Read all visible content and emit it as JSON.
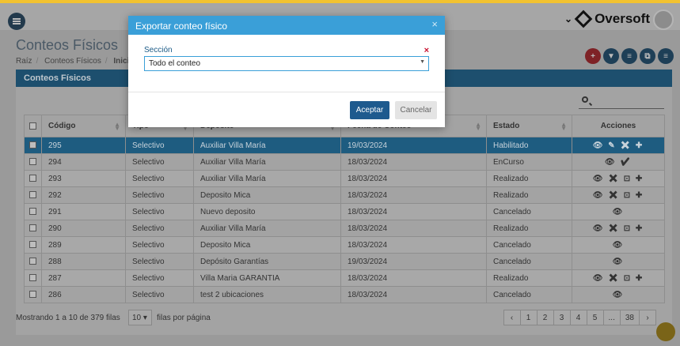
{
  "header": {
    "brand": "Oversoft"
  },
  "page": {
    "title": "Conteos Físicos",
    "breadcrumb": [
      "Raíz",
      "Conteos Físicos",
      "Inicio"
    ],
    "action_circles": [
      "+",
      "▼",
      "≡",
      "⧉",
      "≡"
    ]
  },
  "panel": {
    "title": "Conteos Físicos"
  },
  "table": {
    "columns": [
      "Código",
      "Tipo",
      "Depósito",
      "Fecha de Conteo",
      "Estado",
      "Acciones"
    ],
    "rows": [
      {
        "codigo": "295",
        "tipo": "Selectivo",
        "deposito": "Auxiliar Villa María",
        "fecha": "19/03/2024",
        "estado": "Habilitado",
        "acciones": "👁 ✎ ✖ ✚"
      },
      {
        "codigo": "294",
        "tipo": "Selectivo",
        "deposito": "Auxiliar Villa María",
        "fecha": "18/03/2024",
        "estado": "EnCurso",
        "acciones": "👁 ✔"
      },
      {
        "codigo": "293",
        "tipo": "Selectivo",
        "deposito": "Auxiliar Villa María",
        "fecha": "18/03/2024",
        "estado": "Realizado",
        "acciones": "👁 ✖ ⊡ ✚"
      },
      {
        "codigo": "292",
        "tipo": "Selectivo",
        "deposito": "Deposito Mica",
        "fecha": "18/03/2024",
        "estado": "Realizado",
        "acciones": "👁 ✖ ⊡ ✚"
      },
      {
        "codigo": "291",
        "tipo": "Selectivo",
        "deposito": "Nuevo deposito",
        "fecha": "18/03/2024",
        "estado": "Cancelado",
        "acciones": "👁"
      },
      {
        "codigo": "290",
        "tipo": "Selectivo",
        "deposito": "Auxiliar Villa María",
        "fecha": "18/03/2024",
        "estado": "Realizado",
        "acciones": "👁 ✖ ⊡ ✚"
      },
      {
        "codigo": "289",
        "tipo": "Selectivo",
        "deposito": "Deposito Mica",
        "fecha": "18/03/2024",
        "estado": "Cancelado",
        "acciones": "👁"
      },
      {
        "codigo": "288",
        "tipo": "Selectivo",
        "deposito": "Depósito Garantías",
        "fecha": "19/03/2024",
        "estado": "Cancelado",
        "acciones": "👁"
      },
      {
        "codigo": "287",
        "tipo": "Selectivo",
        "deposito": "Villa Maria GARANTIA",
        "fecha": "18/03/2024",
        "estado": "Realizado",
        "acciones": "👁 ✖ ⊡ ✚"
      },
      {
        "codigo": "286",
        "tipo": "Selectivo",
        "deposito": "test 2 ubicaciones",
        "fecha": "18/03/2024",
        "estado": "Cancelado",
        "acciones": "👁"
      }
    ]
  },
  "footer": {
    "info": "Mostrando 1 a 10 de 379 filas",
    "page_size": "10",
    "page_size_label": "filas por página",
    "pages": [
      "‹",
      "1",
      "2",
      "3",
      "4",
      "5",
      "...",
      "38",
      "›"
    ]
  },
  "modal": {
    "title": "Exportar conteo físico",
    "close": "×",
    "field_label": "Sección",
    "field_clear": "×",
    "select_value": "Todo el conteo",
    "accept": "Aceptar",
    "cancel": "Cancelar"
  }
}
